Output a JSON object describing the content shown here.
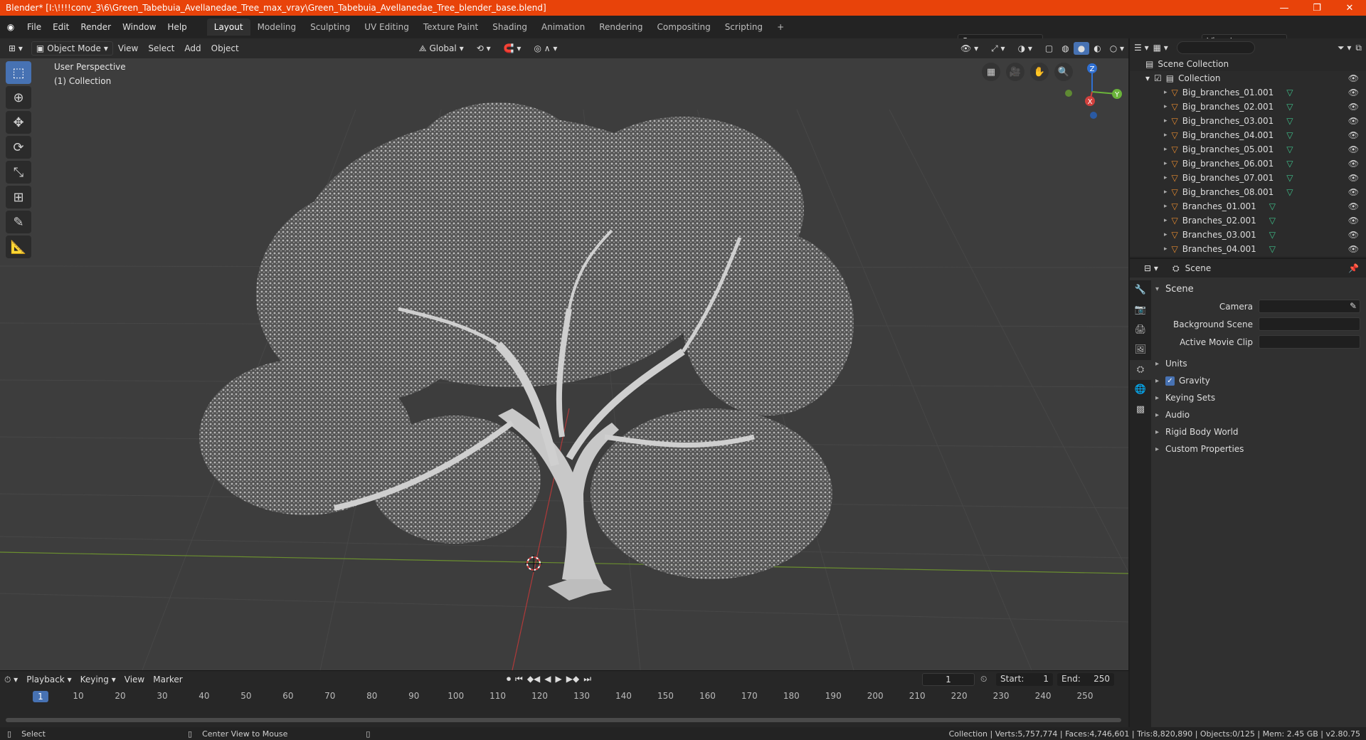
{
  "titlebar": {
    "title": "Blender* [I:\\!!!!conv_3\\6\\Green_Tabebuia_Avellanedae_Tree_max_vray\\Green_Tabebuia_Avellanedae_Tree_blender_base.blend]",
    "minimize": "—",
    "maximize": "❐",
    "close": "✕"
  },
  "menubar": {
    "items": [
      "File",
      "Edit",
      "Render",
      "Window",
      "Help"
    ],
    "tabs": [
      "Layout",
      "Modeling",
      "Sculpting",
      "UV Editing",
      "Texture Paint",
      "Shading",
      "Animation",
      "Rendering",
      "Compositing",
      "Scripting"
    ],
    "add_tab": "+",
    "scene": "Scene",
    "view_layer": "View Layer"
  },
  "viewport": {
    "mode": "Object Mode",
    "menus": [
      "View",
      "Select",
      "Add",
      "Object"
    ],
    "transform": "Global",
    "info_line1": "User Perspective",
    "info_line2": "(1) Collection",
    "gizmo": {
      "z": "Z",
      "y": "Y",
      "x": "X"
    }
  },
  "timeline": {
    "menus": [
      "Playback",
      "Keying",
      "View",
      "Marker"
    ],
    "current_frame": "1",
    "start_label": "Start:",
    "start": "1",
    "end_label": "End:",
    "end": "250",
    "ruler": [
      "1",
      "10",
      "20",
      "30",
      "40",
      "50",
      "60",
      "70",
      "80",
      "90",
      "100",
      "110",
      "120",
      "130",
      "140",
      "150",
      "160",
      "170",
      "180",
      "190",
      "200",
      "210",
      "220",
      "230",
      "240",
      "250"
    ]
  },
  "statusbar": {
    "select": "Select",
    "center": "Center View to Mouse",
    "stats": "Collection | Verts:5,757,774 | Faces:4,746,601 | Tris:8,820,890 | Objects:0/125 | Mem: 2.45 GB | v2.80.75"
  },
  "outliner": {
    "root": "Scene Collection",
    "collection": "Collection",
    "items": [
      "Big_branches_01.001",
      "Big_branches_02.001",
      "Big_branches_03.001",
      "Big_branches_04.001",
      "Big_branches_05.001",
      "Big_branches_06.001",
      "Big_branches_07.001",
      "Big_branches_08.001",
      "Branches_01.001",
      "Branches_02.001",
      "Branches_03.001",
      "Branches_04.001"
    ]
  },
  "properties": {
    "header": "Scene",
    "section": "Scene",
    "camera_label": "Camera",
    "background_label": "Background Scene",
    "movieclip_label": "Active Movie Clip",
    "subsections": [
      "Units",
      "Gravity",
      "Keying Sets",
      "Audio",
      "Rigid Body World",
      "Custom Properties"
    ]
  },
  "colors": {
    "titlebar": "#e8430a",
    "accent": "#4772b3",
    "viewport_bg": "#3d3d3d"
  }
}
